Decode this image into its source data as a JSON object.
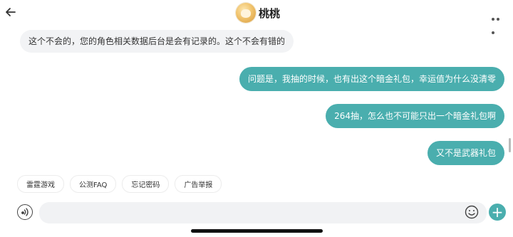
{
  "header": {
    "title": "桃桃",
    "back_icon": "back-arrow-icon",
    "more_icon": "more-dots-icon"
  },
  "messages": [
    {
      "side": "left",
      "text": "这个不会的，您的角色相关数据后台是会有记录的。这个不会有错的"
    },
    {
      "side": "right",
      "text": "问题是，我抽的时候，也有出这个暗金礼包，幸运值为什么没清零"
    },
    {
      "side": "right",
      "text": "264抽，怎么也不可能只出一个暗金礼包啊"
    },
    {
      "side": "right",
      "text": "又不是武器礼包"
    }
  ],
  "quick_replies": [
    "雷霆游戏",
    "公测FAQ",
    "忘记密码",
    "广告举报"
  ],
  "composer": {
    "input_value": "",
    "voice_icon": "voice-icon",
    "emoji_icon": "emoji-icon",
    "plus_label": "+"
  },
  "colors": {
    "accent": "#4aaeae",
    "left_bubble": "#f2f3f5"
  }
}
